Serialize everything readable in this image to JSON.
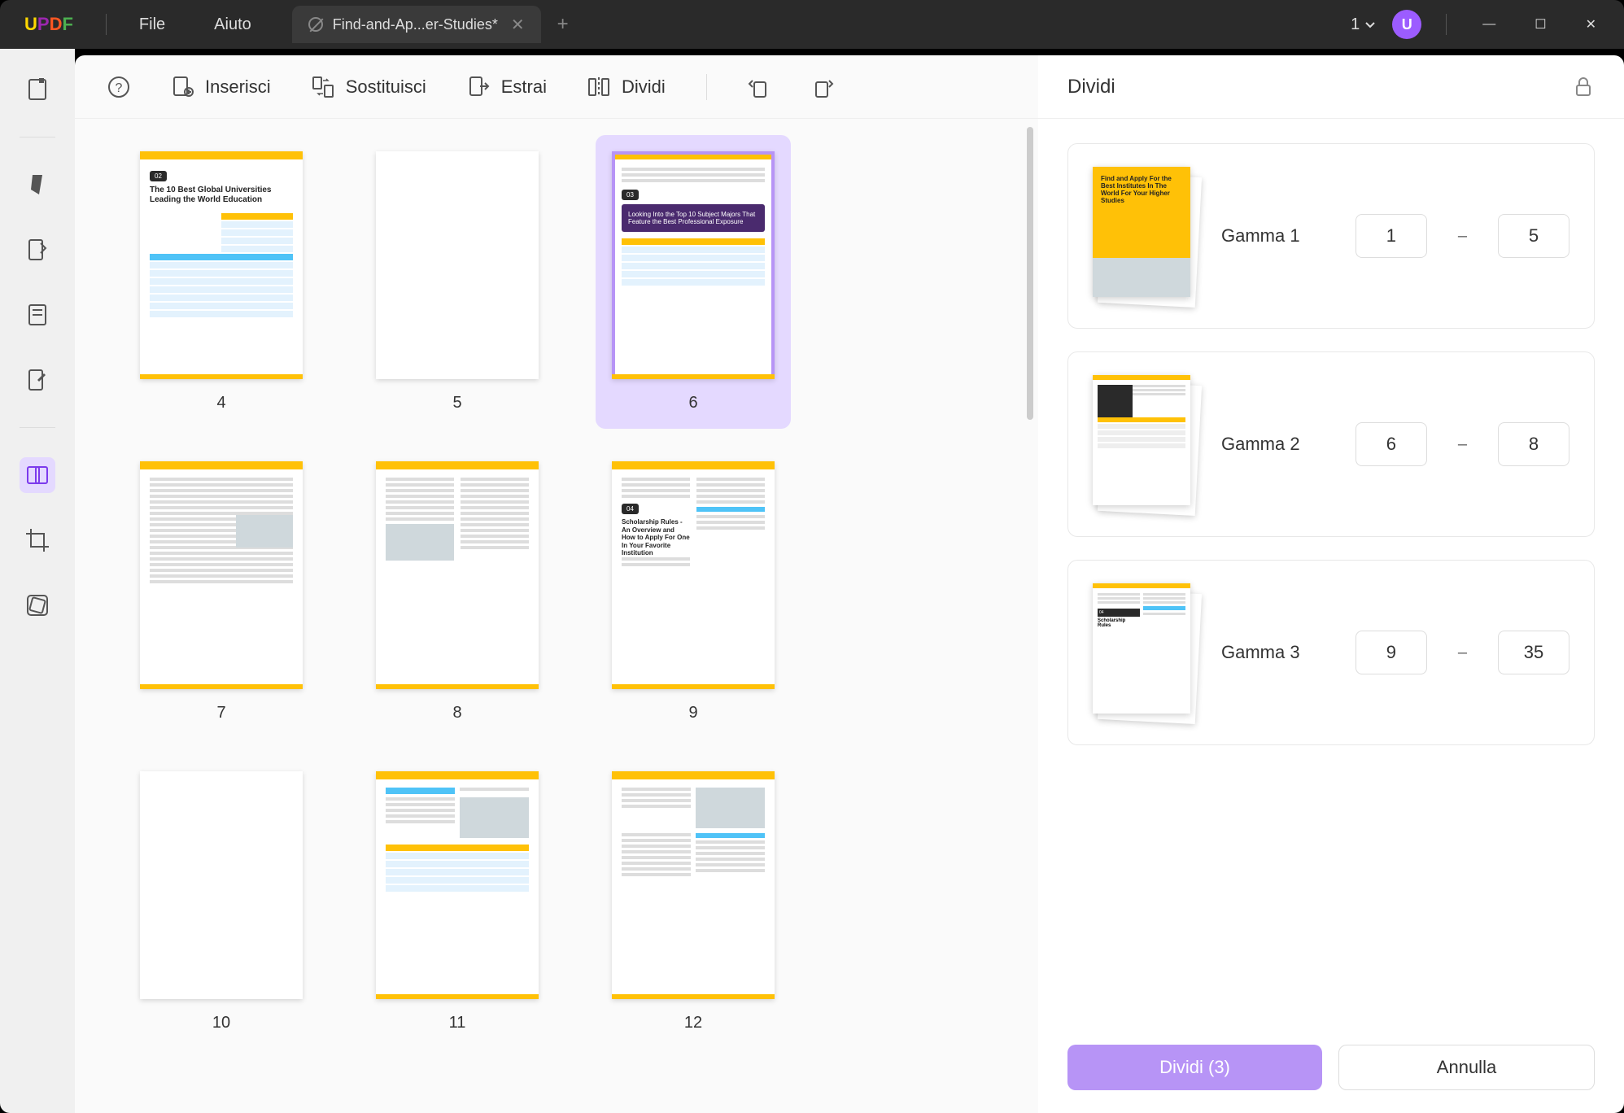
{
  "titleBar": {
    "menuFile": "File",
    "menuHelp": "Aiuto",
    "tabName": "Find-and-Ap...er-Studies*",
    "pageIndicator": "1",
    "userInitial": "U"
  },
  "toolbar": {
    "insert": "Inserisci",
    "replace": "Sostituisci",
    "extract": "Estrai",
    "split": "Dividi"
  },
  "thumbnails": [
    {
      "num": "4"
    },
    {
      "num": "5"
    },
    {
      "num": "6"
    },
    {
      "num": "7"
    },
    {
      "num": "8"
    },
    {
      "num": "9"
    },
    {
      "num": "10"
    },
    {
      "num": "11"
    },
    {
      "num": "12"
    }
  ],
  "rightPanel": {
    "title": "Dividi",
    "groups": [
      {
        "name": "Gamma 1",
        "from": "1",
        "to": "5"
      },
      {
        "name": "Gamma 2",
        "from": "6",
        "to": "8"
      },
      {
        "name": "Gamma 3",
        "from": "9",
        "to": "35"
      }
    ],
    "splitBtn": "Dividi (3)",
    "cancelBtn": "Annulla"
  },
  "docContent": {
    "page4": {
      "badge": "02",
      "title": "The 10 Best Global Universities Leading the World Education"
    },
    "page6": {
      "badge": "03",
      "title": "Looking Into the Top 10 Subject Majors That Feature the Best Professional Exposure"
    },
    "page9": {
      "badge": "04",
      "title": "Scholarship Rules - An Overview and How to Apply For One In Your Favorite Institution"
    },
    "gamma1": "Find and Apply For the Best Institutes In The World For Your Higher Studies"
  }
}
